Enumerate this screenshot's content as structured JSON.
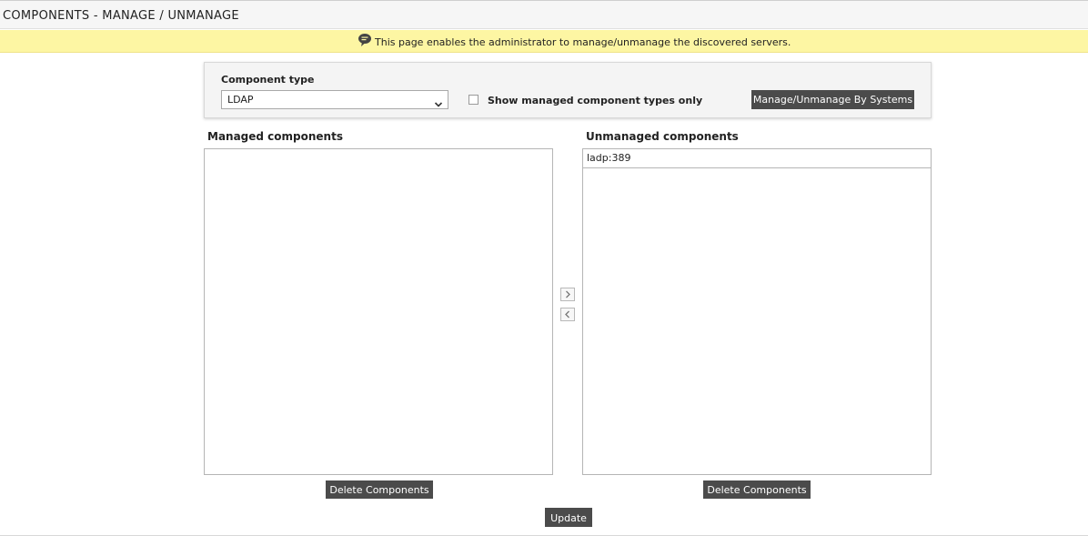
{
  "page": {
    "title": "COMPONENTS - MANAGE / UNMANAGE",
    "info_message": "This page enables the administrator to manage/unmanage the discovered servers."
  },
  "filter": {
    "component_type_label": "Component type",
    "component_type_selected": "LDAP",
    "show_managed_label": "Show managed component types only",
    "show_managed_checked": false,
    "manage_by_systems_label": "Manage/Unmanage By Systems"
  },
  "managed": {
    "label": "Managed components",
    "items": [],
    "delete_label": "Delete Components"
  },
  "unmanaged": {
    "label": "Unmanaged components",
    "items": [
      "ladp:389"
    ],
    "delete_label": "Delete Components"
  },
  "actions": {
    "move_right_icon": "chevron-right-icon",
    "move_left_icon": "chevron-left-icon",
    "update_label": "Update"
  },
  "colors": {
    "info_bar_bg": "#fdf6a3",
    "button_bg": "#4b4b4b",
    "button_text": "#ffffff"
  }
}
